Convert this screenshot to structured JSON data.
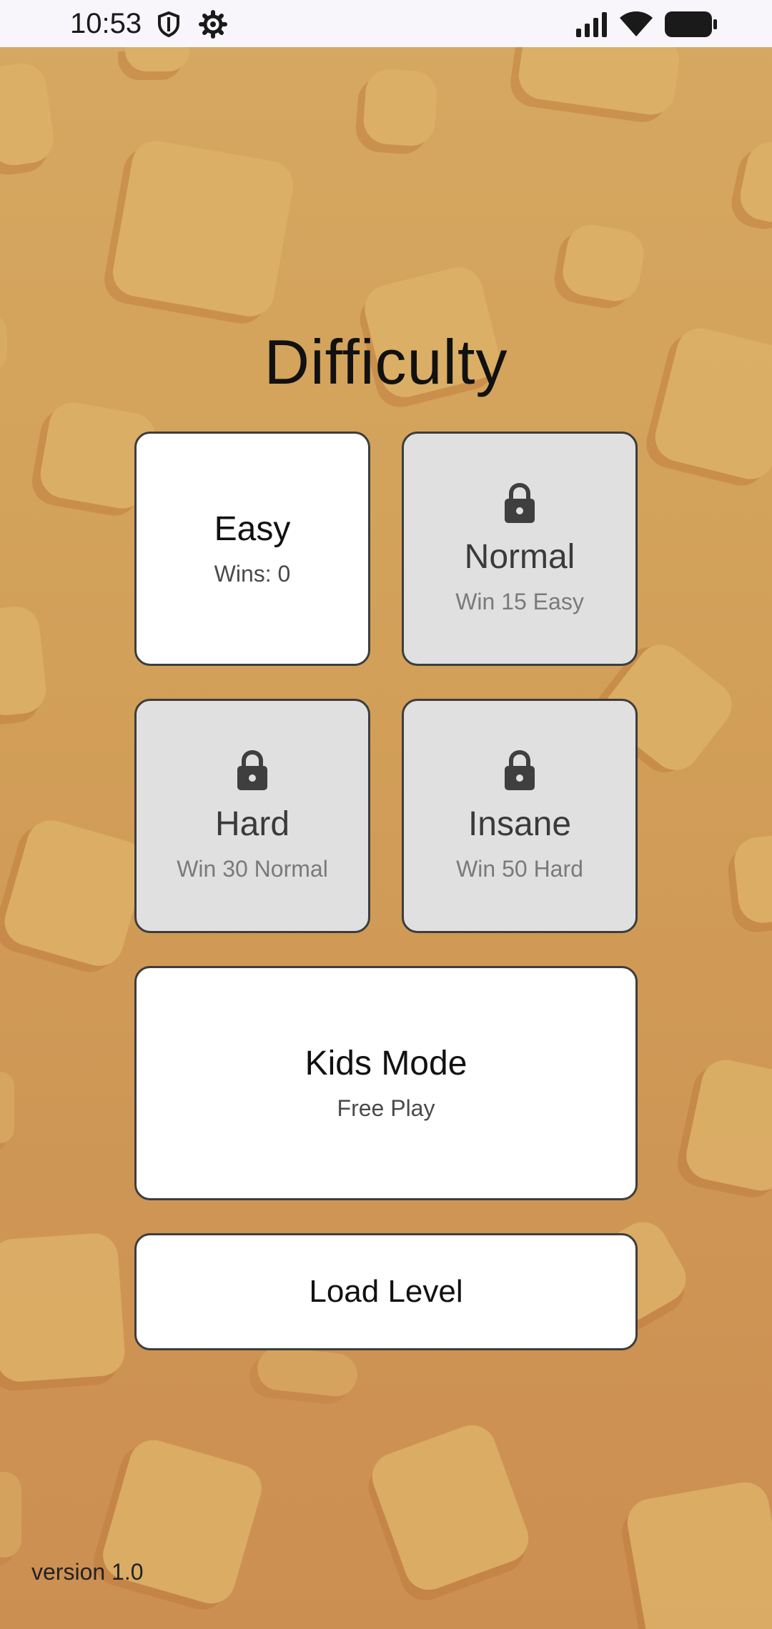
{
  "status_bar": {
    "time": "10:53",
    "icons": [
      "shield-icon",
      "gear-icon",
      "signal-icon",
      "wifi-icon",
      "battery-icon"
    ]
  },
  "title": "Difficulty",
  "difficulties": [
    {
      "name": "Easy",
      "subtitle": "Wins: 0",
      "locked": false
    },
    {
      "name": "Normal",
      "subtitle": "Win 15 Easy",
      "locked": true
    },
    {
      "name": "Hard",
      "subtitle": "Win 30 Normal",
      "locked": true
    },
    {
      "name": "Insane",
      "subtitle": "Win 50 Hard",
      "locked": true
    }
  ],
  "kids_mode": {
    "name": "Kids Mode",
    "subtitle": "Free Play"
  },
  "load_level": {
    "label": "Load Level"
  },
  "version": "version 1.0",
  "colors": {
    "background_top": "#d6a861",
    "background_bottom": "#cc8f52",
    "card_unlocked": "#ffffff",
    "card_locked": "#e0e0e0",
    "card_border": "#3d3d3d"
  }
}
